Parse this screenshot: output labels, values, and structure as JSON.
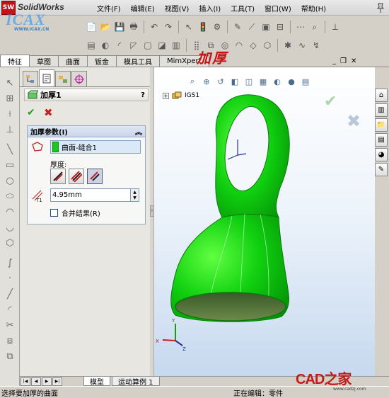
{
  "app": {
    "logo_text": "SolidWorks",
    "logo_badge": "SW",
    "watermark_top": "ICAX",
    "watermark_top_url": "WWW.ICAX.CN"
  },
  "menu": [
    "文件(F)",
    "编辑(E)",
    "视图(V)",
    "插入(I)",
    "工具(T)",
    "窗口(W)",
    "帮助(H)"
  ],
  "command_tabs": [
    "特征",
    "草图",
    "曲面",
    "钣金",
    "模具工具",
    "MimXpert"
  ],
  "overlay_title": "加厚",
  "property_manager": {
    "title": "加厚1",
    "help": "?",
    "group_title": "加厚参数(I)",
    "selection": "曲面-缝合1",
    "thickness_label": "厚度:",
    "thickness_value": "4.95mm",
    "merge_label": "合并结果(R)"
  },
  "tree": {
    "root": "IGS1"
  },
  "bottom_tabs": [
    "模型",
    "运动算例 1"
  ],
  "status": {
    "left": "选择要加厚的曲面",
    "right": "正在编辑：零件"
  },
  "watermark_bottom": {
    "brand": "CAD之家",
    "url": "www.cadzj.com"
  },
  "colors": {
    "model": "#10d010",
    "accent": "#c81414"
  }
}
